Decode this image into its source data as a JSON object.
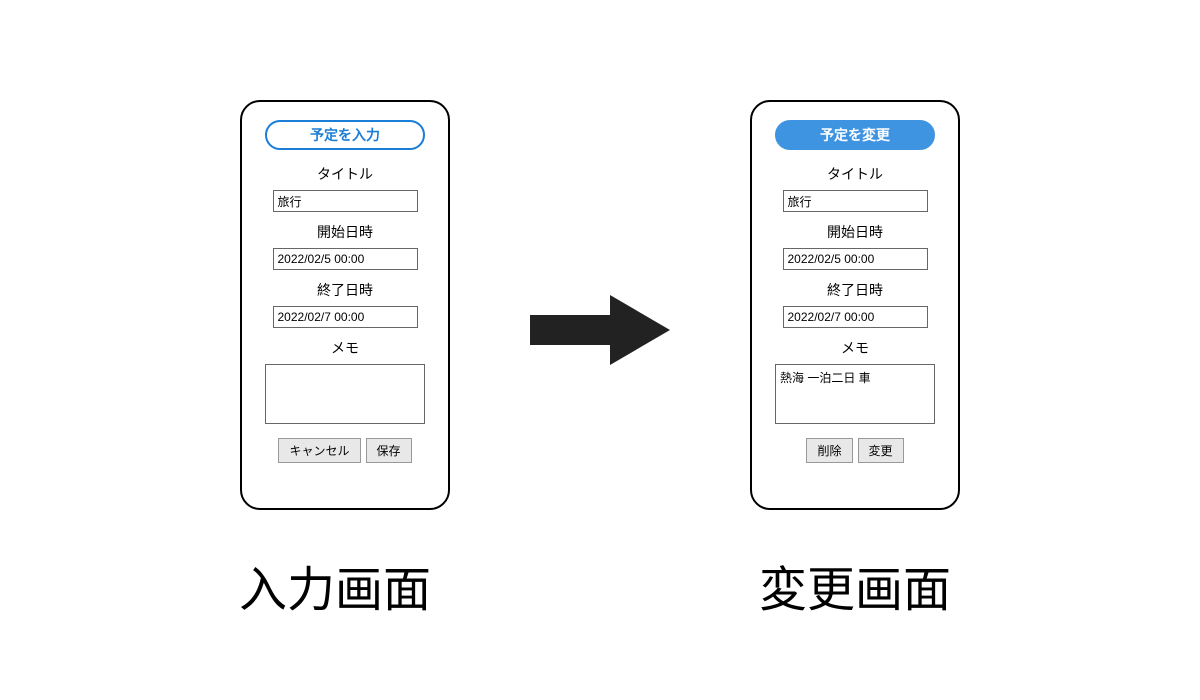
{
  "left": {
    "header": "予定を入力",
    "title_label": "タイトル",
    "title_value": "旅行",
    "start_label": "開始日時",
    "start_value": "2022/02/5 00:00",
    "end_label": "終了日時",
    "end_value": "2022/02/7 00:00",
    "memo_label": "メモ",
    "memo_value": "",
    "cancel_btn": "キャンセル",
    "save_btn": "保存",
    "caption": "入力画面"
  },
  "right": {
    "header": "予定を変更",
    "title_label": "タイトル",
    "title_value": "旅行",
    "start_label": "開始日時",
    "start_value": "2022/02/5 00:00",
    "end_label": "終了日時",
    "end_value": "2022/02/7 00:00",
    "memo_label": "メモ",
    "memo_value": "熱海 一泊二日 車",
    "delete_btn": "削除",
    "change_btn": "変更",
    "caption": "変更画面"
  }
}
